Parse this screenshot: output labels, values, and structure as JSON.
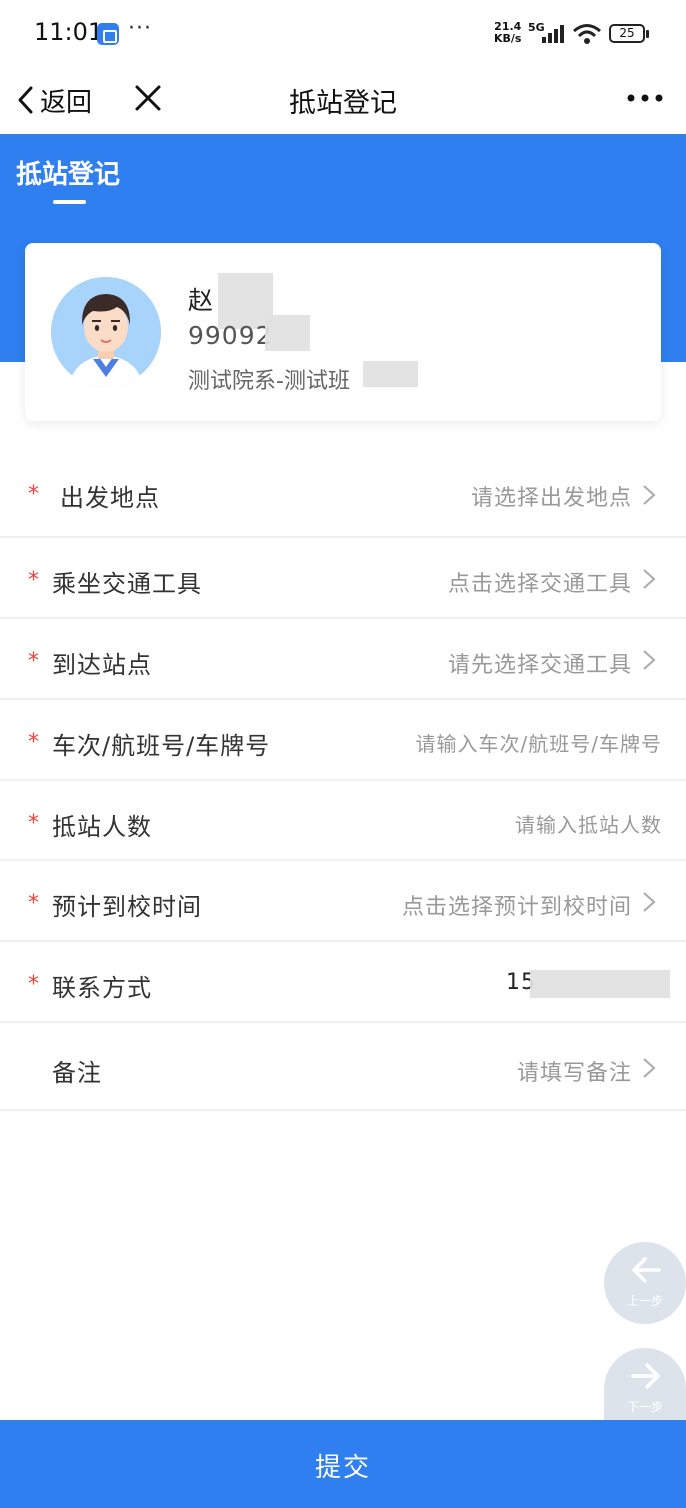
{
  "status_bar": {
    "time": "11:01",
    "more": "···",
    "speed_value": "21.4",
    "speed_unit": "KB/s",
    "network": "5G",
    "battery": "25"
  },
  "nav": {
    "back_label": "返回",
    "title": "抵站登记"
  },
  "header": {
    "tab_label": "抵站登记"
  },
  "profile": {
    "name": "赵",
    "student_id": "99092",
    "department": "测试院系-测试班"
  },
  "form": {
    "rows": [
      {
        "label": "出发地点",
        "value": "请选择出发地点",
        "required": "*"
      },
      {
        "label": "乘坐交通工具",
        "value": "点击选择交通工具",
        "required": "*"
      },
      {
        "label": "到达站点",
        "value": "请先选择交通工具",
        "required": "*"
      },
      {
        "label": "车次/航班号/车牌号",
        "value": "请输入车次/航班号/车牌号",
        "required": "*"
      },
      {
        "label": "抵站人数",
        "value": "请输入抵站人数",
        "required": "*"
      },
      {
        "label": "预计到校时间",
        "value": "点击选择预计到校时间",
        "required": "*"
      },
      {
        "label": "联系方式",
        "value": "15",
        "required": "*"
      },
      {
        "label": "备注",
        "value": "请填写备注"
      }
    ]
  },
  "fab": {
    "prev_label": "上一步",
    "next_label": "下一步"
  },
  "submit": {
    "label": "提交"
  },
  "colors": {
    "primary": "#2f7ff0",
    "required": "#e8453c",
    "placeholder": "#999999"
  }
}
